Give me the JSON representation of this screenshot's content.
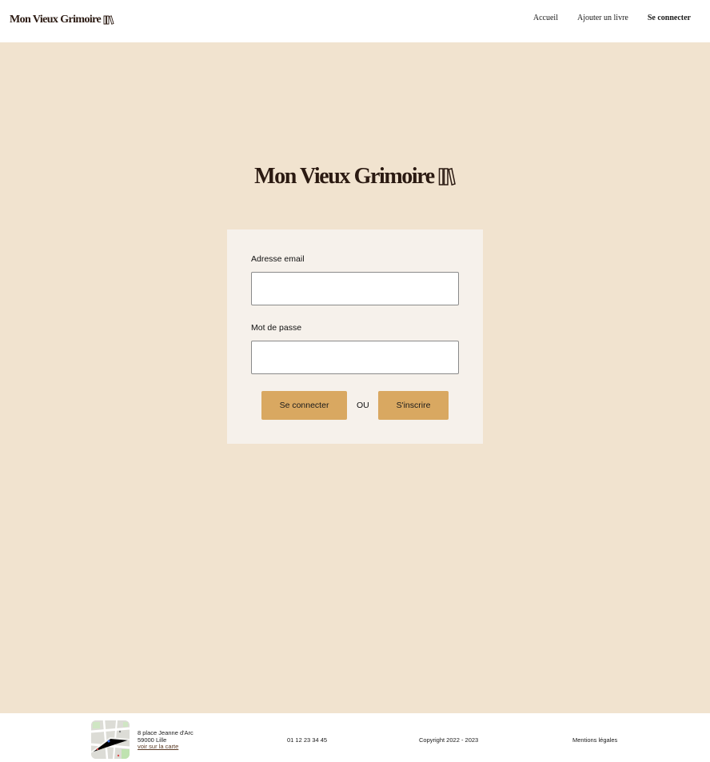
{
  "header": {
    "brand": "Mon Vieux Grimoire",
    "nav": [
      {
        "label": "Accueil"
      },
      {
        "label": "Ajouter un livre"
      },
      {
        "label": "Se connecter",
        "active": true
      }
    ]
  },
  "hero": {
    "title": "Mon Vieux Grimoire"
  },
  "login": {
    "email_label": "Adresse email",
    "email_value": "",
    "password_label": "Mot de passe",
    "password_value": "",
    "login_button": "Se connecter",
    "separator": "OU",
    "signup_button": "S'inscrire"
  },
  "footer": {
    "address_line1": "8 place Jeanne d'Arc",
    "address_line2": "59000 Lille",
    "map_link": "voir sur la carte",
    "phone": "01 12 23 34 45",
    "copyright": "Copyright 2022 - 2023",
    "legal": "Mentions légales"
  },
  "colors": {
    "page_background": "#F1E3CF",
    "card_background": "#F6F1EB",
    "button": "#D9A861",
    "brand_text": "#2b1a12"
  },
  "icons": {
    "logo": "book-pair-icon",
    "map": "map-thumbnail"
  }
}
